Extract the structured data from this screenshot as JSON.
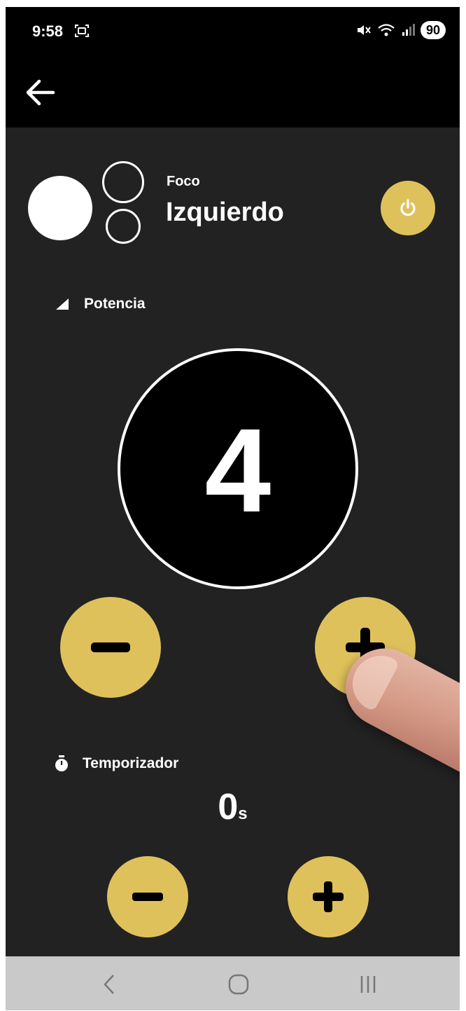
{
  "status_bar": {
    "time": "9:58",
    "battery": "90"
  },
  "device": {
    "label": "Foco",
    "name": "Izquierdo"
  },
  "power": {
    "title": "Potencia",
    "value": "4"
  },
  "timer": {
    "title": "Temporizador",
    "value": "0",
    "unit": "s"
  },
  "colors": {
    "accent": "#dfc15c",
    "background": "#222222",
    "bar": "#000000",
    "navbar": "#c9c9c9"
  },
  "icons": {
    "back": "arrow-left-icon",
    "power": "power-icon",
    "power_level": "signal-triangle-icon",
    "timer": "stopwatch-icon",
    "minus": "minus-icon",
    "plus": "plus-icon"
  }
}
